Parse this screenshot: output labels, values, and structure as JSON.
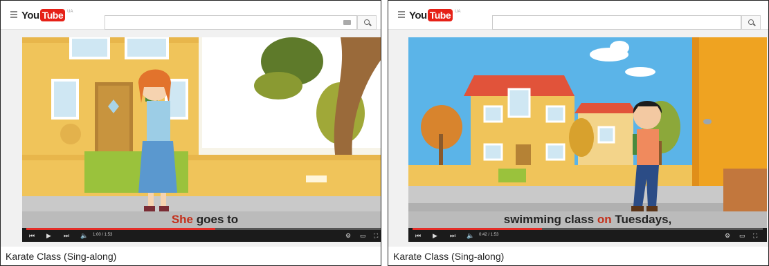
{
  "panels": [
    {
      "masthead": {
        "logo_you": "You",
        "logo_tube": "Tube",
        "logo_country": "UA",
        "search_placeholder": ""
      },
      "caption": {
        "highlight": "She",
        "rest": " goes to"
      },
      "player": {
        "time": "1:00 / 1:53",
        "progress": 0.53
      },
      "video_title": "Karate Class (Sing-along)"
    },
    {
      "masthead": {
        "logo_you": "You",
        "logo_tube": "Tube",
        "logo_country": "UA",
        "search_placeholder": ""
      },
      "caption": {
        "part1": "swimming class ",
        "highlight": "on",
        "part2": " Tuesdays,"
      },
      "player": {
        "time": "0:42 / 1:53",
        "progress": 0.37
      },
      "video_title": "Karate Class (Sing-along)"
    }
  ],
  "colors": {
    "youtube_red": "#e62117",
    "progress_red": "#e52d27",
    "caption_highlight": "#c4301b"
  },
  "icons": {
    "menu": "hamburger-icon",
    "search": "search-icon",
    "keyboard": "keyboard-icon",
    "prev": "previous-icon",
    "play": "play-icon",
    "next": "next-icon",
    "volume": "volume-icon",
    "settings": "gear-icon",
    "theater": "theater-mode-icon",
    "fullscreen": "fullscreen-icon"
  }
}
